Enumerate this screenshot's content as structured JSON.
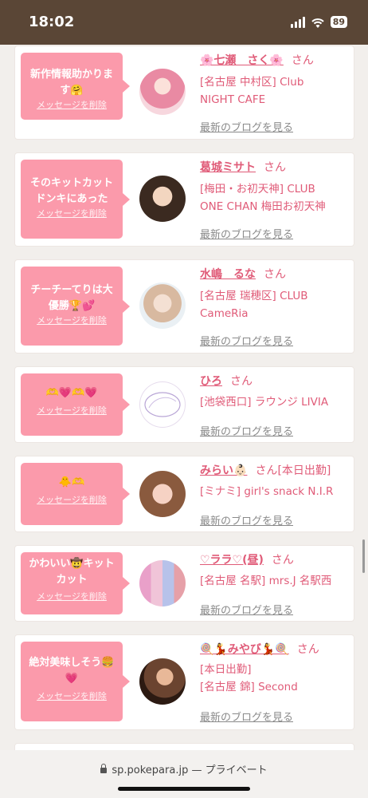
{
  "status_bar": {
    "time": "18:02",
    "battery": "89"
  },
  "cards": [
    {
      "message": "新作情報助かりま す🤗",
      "delete_label": "メッセージを削除",
      "name": "🌸七瀬　さく🌸",
      "san": "さん",
      "extra": "",
      "detail_lines": [
        "[名古屋 中村区] Club",
        "NIGHT CAFE"
      ],
      "blog_label": "最新のブログを見る"
    },
    {
      "message": "そのキットカット ドンキにあった",
      "delete_label": "メッセージを削除",
      "name": "葛城ミサト",
      "san": "さん",
      "extra": "",
      "detail_lines": [
        "[梅田・お初天神] CLUB",
        "ONE CHAN 梅田お初天神"
      ],
      "blog_label": "最新のブログを見る"
    },
    {
      "message": "チーチーてりは大 優勝🏆💕",
      "delete_label": "メッセージを削除",
      "name": "水嶋　るな",
      "san": "さん",
      "extra": "",
      "detail_lines": [
        "[名古屋 瑞穂区] CLUB",
        "CameRia"
      ],
      "blog_label": "最新のブログを見る"
    },
    {
      "message": "🫶💗🫶💗",
      "delete_label": "メッセージを削除",
      "name": "ひろ",
      "san": "さん",
      "extra": "",
      "detail_lines": [
        "[池袋西口] ラウンジ LIVIA"
      ],
      "blog_label": "最新のブログを見る"
    },
    {
      "message": "🐥🫶",
      "delete_label": "メッセージを削除",
      "name": "みらい👶🏻",
      "san": "さん",
      "extra": "[本日出勤]",
      "detail_lines": [
        "[ミナミ] girl's snack N.I.R"
      ],
      "blog_label": "最新のブログを見る"
    },
    {
      "message": "かわいい🤠キット カット",
      "delete_label": "メッセージを削除",
      "name": "♡ララ♡(昼)",
      "san": "さん",
      "extra": "",
      "detail_lines": [
        "[名古屋 名駅] mrs.J 名駅西"
      ],
      "blog_label": "最新のブログを見る"
    },
    {
      "message": "絶対美味しそう🍔 💗",
      "delete_label": "メッセージを削除",
      "name": "🍭💃みやび💃🍭",
      "san": "さん",
      "extra": "",
      "detail_lines": [
        "[本日出勤]",
        "[名古屋 錦] Second"
      ],
      "blog_label": "最新のブログを見る"
    }
  ],
  "bottom_bar": {
    "url": "sp.pokepara.jp",
    "privacy": "— プライベート"
  }
}
